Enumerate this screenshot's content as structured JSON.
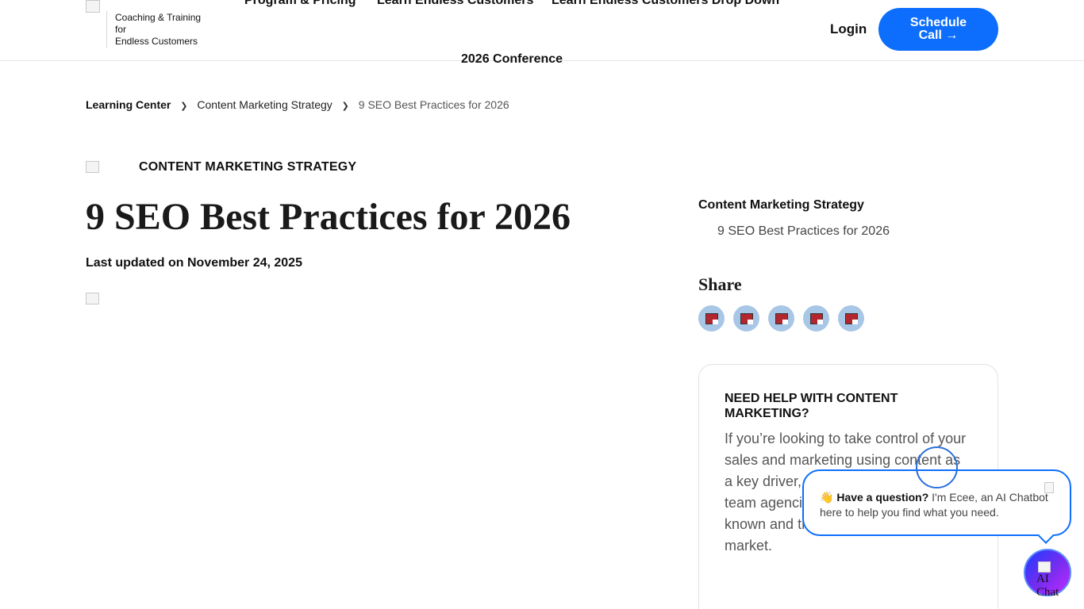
{
  "header": {
    "logo_lines": [
      "Coaching & Training",
      "for",
      "Endless Customers"
    ],
    "nav": [
      "Program & Pricing",
      "Learn Endless Customers",
      "Learn Endless Customers Drop Down"
    ],
    "nav_second_row": "2026 Conference",
    "login_label": "Login",
    "cta_line1": "Schedule",
    "cta_line2": "Call →"
  },
  "breadcrumb": [
    "Learning Center",
    "Content Marketing Strategy",
    "9 SEO Best Practices for 2026"
  ],
  "breadcrumb_separator": "❯",
  "article": {
    "category": "CONTENT MARKETING STRATEGY",
    "title": "9 SEO Best Practices for 2026",
    "updated": "Last updated on November 24, 2025"
  },
  "sidebar": {
    "toc_heading": "Content Marketing Strategy",
    "toc_item": "9 SEO Best Practices for 2026",
    "share_heading": "Share",
    "share_icons": [
      "share-icon-1",
      "share-icon-2",
      "share-icon-3",
      "share-icon-4",
      "share-icon-5"
    ],
    "help_title": "NEED HELP WITH CONTENT MARKETING?",
    "help_body": "If you’re looking to take control of your sales and marketing using content as a key driver, can guide yo internal team agencies, and become the most known and trusted brand in your market."
  },
  "chat": {
    "emoji": "👋",
    "question": "Have a question?",
    "message": " I'm Ecee, an AI Chatbot here to help you find what you need.",
    "button_line1": "AI",
    "button_line2": "Chat"
  },
  "colors": {
    "accent": "#0d6efd",
    "share_bg": "#a8c6e6"
  }
}
